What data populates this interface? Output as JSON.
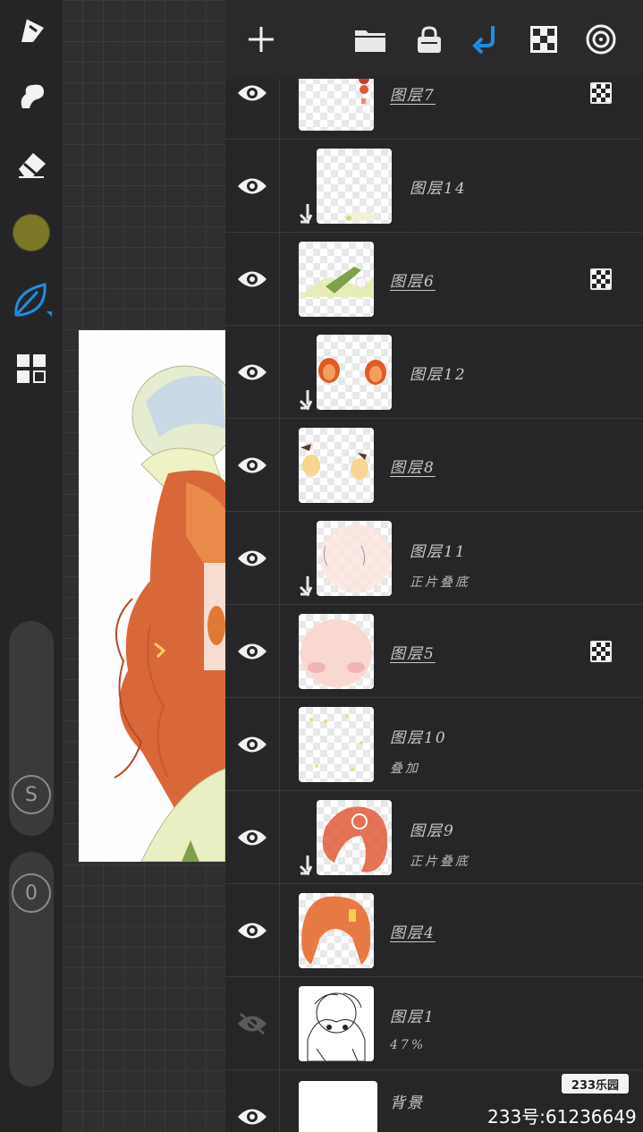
{
  "toolbar": {
    "tools": [
      {
        "name": "brush-icon"
      },
      {
        "name": "smudge-icon"
      },
      {
        "name": "eraser-icon"
      },
      {
        "name": "color-swatch",
        "color": "#7c7828"
      },
      {
        "name": "leaf-brush-icon",
        "color": "#1e8fe0"
      },
      {
        "name": "layers-icon"
      }
    ],
    "size_slider_label": "S",
    "opacity_slider_label": "0"
  },
  "panel": {
    "header_icons": [
      "plus-icon",
      "folder-icon",
      "lock-icon",
      "merge-down-icon",
      "checker-icon",
      "target-icon"
    ],
    "accent_color": "#1e8fe0",
    "layers": [
      {
        "name": "图层7",
        "mode": "",
        "clipped": false,
        "visible": true,
        "alpha_lock": true
      },
      {
        "name": "图层14",
        "mode": "",
        "clipped": true,
        "visible": true,
        "alpha_lock": false
      },
      {
        "name": "图层6",
        "mode": "",
        "clipped": false,
        "visible": true,
        "alpha_lock": true
      },
      {
        "name": "图层12",
        "mode": "",
        "clipped": true,
        "visible": true,
        "alpha_lock": false
      },
      {
        "name": "图层8",
        "mode": "",
        "clipped": false,
        "visible": true,
        "alpha_lock": false
      },
      {
        "name": "图层11",
        "mode": "正片叠底",
        "clipped": true,
        "visible": true,
        "alpha_lock": false
      },
      {
        "name": "图层5",
        "mode": "",
        "clipped": false,
        "visible": true,
        "alpha_lock": true
      },
      {
        "name": "图层10",
        "mode": "叠加",
        "clipped": false,
        "visible": true,
        "alpha_lock": false
      },
      {
        "name": "图层9",
        "mode": "正片叠底",
        "clipped": true,
        "visible": true,
        "alpha_lock": false
      },
      {
        "name": "图层4",
        "mode": "",
        "clipped": false,
        "visible": true,
        "alpha_lock": false
      },
      {
        "name": "图层1",
        "mode": "47%",
        "clipped": false,
        "visible": false,
        "alpha_lock": false
      },
      {
        "name": "背景",
        "mode": "",
        "clipped": false,
        "visible": true,
        "alpha_lock": false
      }
    ]
  },
  "watermark": {
    "logo": "233乐园",
    "id_text": "233号:61236649"
  }
}
